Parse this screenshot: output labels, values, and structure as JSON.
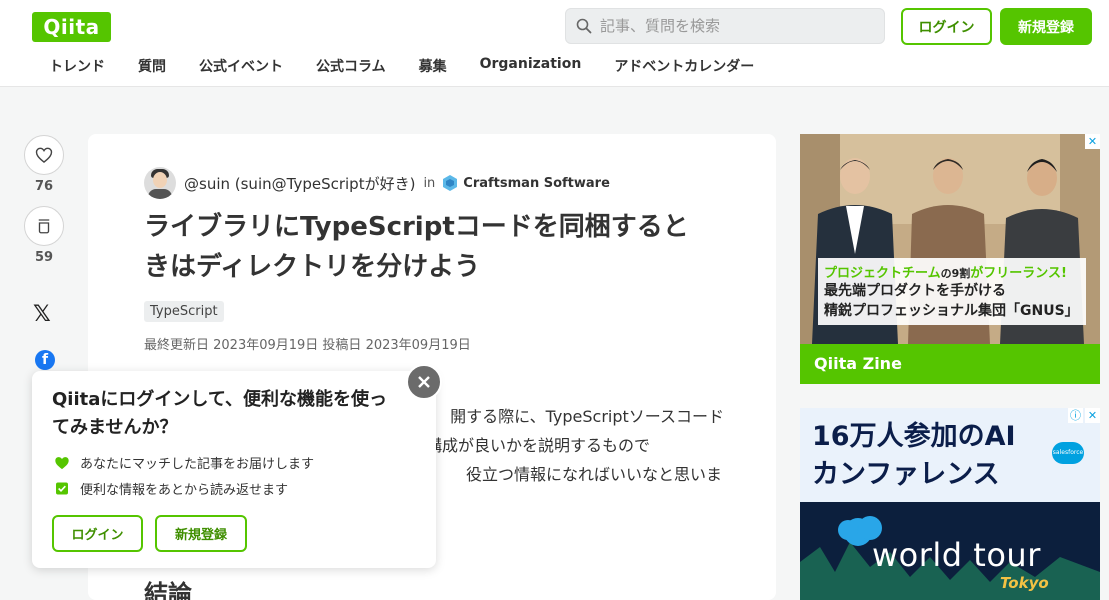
{
  "header": {
    "logo": "Qiita",
    "search_placeholder": "記事、質問を検索",
    "login": "ログイン",
    "signup": "新規登録",
    "nav": [
      "トレンド",
      "質問",
      "公式イベント",
      "公式コラム",
      "募集",
      "Organization",
      "アドベントカレンダー"
    ]
  },
  "rail": {
    "likes": "76",
    "stocks": "59"
  },
  "article": {
    "author": "@suin (suin@TypeScriptが好き)",
    "in": "in",
    "organization": "Craftsman Software",
    "title_line1": "ライブラリにTypeScriptコードを同梱すると",
    "title_line2": "きはディレクトリを分けよう",
    "tag": "TypeScript",
    "dates": "最終更新日 2023年09月19日  投稿日 2023年09月19日",
    "body_line1": "開する際に、TypeScriptソースコード",
    "body_line2": "トリ構成が良いかを説明するもので",
    "body_line3": "役立つ情報になればいいなと思いま",
    "heading": "結論"
  },
  "popup": {
    "title": "Qiitaにログインして、便利な機能を使ってみませんか？",
    "item1": "あなたにマッチした記事をお届けします",
    "item2": "便利な情報をあとから読み返せます",
    "login": "ログイン",
    "signup": "新規登録"
  },
  "ad1": {
    "line1_a": "プロジェクトチーム",
    "line1_b": "の9割",
    "line1_c": "がフリーランス!",
    "line2": "最先端プロダクトを手がける",
    "line3": "精鋭プロフェッショナル集団「GNUS」",
    "footer": "Qiita Zine"
  },
  "ad2": {
    "line1": "16万人参加のAI",
    "line2": "カンファレンス",
    "logo": "salesforce",
    "world": "world tour",
    "tokyo": "Tokyo"
  },
  "colors": {
    "brand_green": "#55c500",
    "facebook_blue": "#1877f2"
  }
}
